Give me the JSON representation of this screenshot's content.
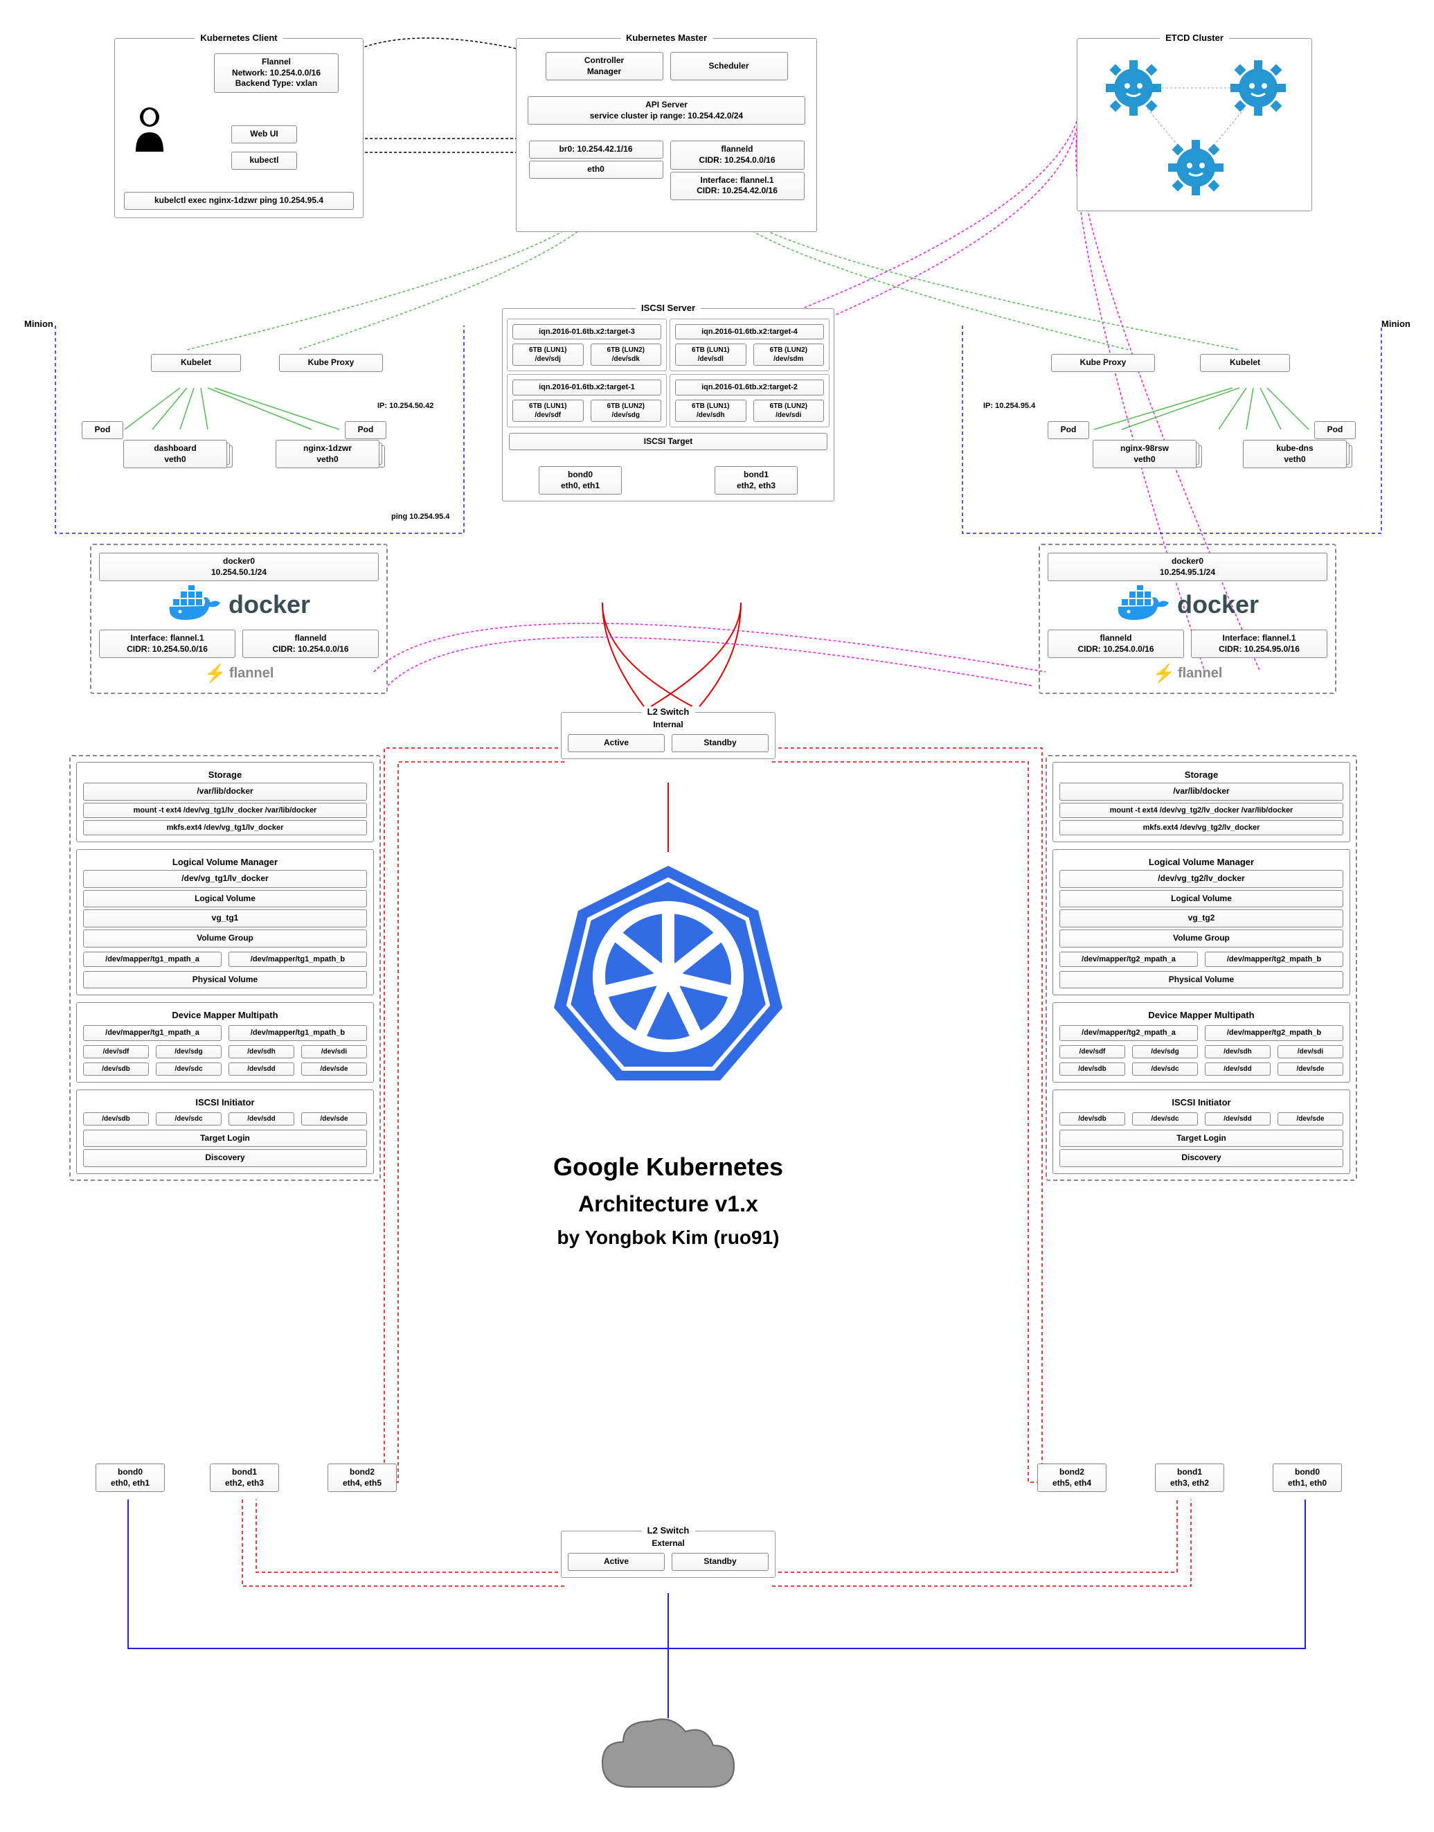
{
  "client": {
    "title": "Kubernetes Client",
    "flannel": "Flannel\nNetwork: 10.254.0.0/16\nBackend Type: vxlan",
    "webui": "Web UI",
    "kubectl": "kubectl",
    "exec": "kubelctl exec nginx-1dzwr ping 10.254.95.4"
  },
  "master": {
    "title": "Kubernetes Master",
    "controller": "Controller\nManager",
    "scheduler": "Scheduler",
    "api_server": "API Server\nservice cluster ip range: 10.254.42.0/24",
    "br0": "br0: 10.254.42.1/16",
    "eth0": "eth0",
    "flanneld": "flanneld\nCIDR: 10.254.0.0/16",
    "interface": "Interface: flannel.1\nCIDR: 10.254.42.0/16"
  },
  "etcd": {
    "title": "ETCD Cluster"
  },
  "iscsi_server": {
    "title": "ISCSI Server",
    "targets": [
      {
        "name": "iqn.2016-01.6tb.x2:target-3",
        "luns": [
          "6TB (LUN1)\n/dev/sdj",
          "6TB (LUN2)\n/dev/sdk"
        ]
      },
      {
        "name": "iqn.2016-01.6tb.x2:target-4",
        "luns": [
          "6TB (LUN1)\n/dev/sdl",
          "6TB (LUN2)\n/dev/sdm"
        ]
      },
      {
        "name": "iqn.2016-01.6tb.x2:target-1",
        "luns": [
          "6TB (LUN1)\n/dev/sdf",
          "6TB (LUN2)\n/dev/sdg"
        ]
      },
      {
        "name": "iqn.2016-01.6tb.x2:target-2",
        "luns": [
          "6TB (LUN1)\n/dev/sdh",
          "6TB (LUN2)\n/dev/sdi"
        ]
      }
    ],
    "target_label": "ISCSI Target",
    "bond0": "bond0\neth0, eth1",
    "bond1": "bond1\neth2, eth3"
  },
  "l2_internal": {
    "title": "L2 Switch",
    "sub": "Internal",
    "active": "Active",
    "standby": "Standby"
  },
  "l2_external": {
    "title": "L2 Switch",
    "sub": "External",
    "active": "Active",
    "standby": "Standby"
  },
  "minion_left": {
    "label": "Minion",
    "kubelet": "Kubelet",
    "kubeproxy": "Kube Proxy",
    "pod1": "Pod",
    "pod2": "Pod",
    "container1": "dashboard\nveth0",
    "container2": "nginx-1dzwr\nveth0",
    "docker0": "docker0\n10.254.50.1/24",
    "docker_logo": "docker",
    "interface": "Interface: flannel.1\nCIDR: 10.254.50.0/16",
    "flanneld": "flanneld\nCIDR: 10.254.0.0/16",
    "flannel_logo": "flannel",
    "ip_ann": "IP: 10.254.50.42",
    "ping_ann": "ping 10.254.95.4",
    "storage": {
      "title": "Storage",
      "varlib": "/var/lib/docker",
      "mount": "mount -t ext4 /dev/vg_tg1/lv_docker /var/lib/docker",
      "mkfs": "mkfs.ext4 /dev/vg_tg1/lv_docker"
    },
    "lvm": {
      "title": "Logical Volume Manager",
      "lv": "/dev/vg_tg1/lv_docker",
      "lv_label": "Logical Volume",
      "vg": "vg_tg1",
      "vg_label": "Volume Group",
      "mpaths": [
        "/dev/mapper/tg1_mpath_a",
        "/dev/mapper/tg1_mpath_b"
      ],
      "pv_label": "Physical Volume"
    },
    "dmm": {
      "title": "Device Mapper Multipath",
      "mpaths": [
        "/dev/mapper/tg1_mpath_a",
        "/dev/mapper/tg1_mpath_b"
      ],
      "devs1": [
        "/dev/sdf",
        "/dev/sdg",
        "/dev/sdh",
        "/dev/sdi"
      ],
      "devs2": [
        "/dev/sdb",
        "/dev/sdc",
        "/dev/sdd",
        "/dev/sde"
      ]
    },
    "iscsi_init": {
      "title": "ISCSI Initiator",
      "devs": [
        "/dev/sdb",
        "/dev/sdc",
        "/dev/sdd",
        "/dev/sde"
      ],
      "target_login": "Target Login",
      "discovery": "Discovery"
    },
    "bonds": {
      "bond0": "bond0\neth0, eth1",
      "bond1": "bond1\neth2, eth3",
      "bond2": "bond2\neth4, eth5"
    }
  },
  "minion_right": {
    "label": "Minion",
    "kubelet": "Kubelet",
    "kubeproxy": "Kube Proxy",
    "pod1": "Pod",
    "pod2": "Pod",
    "container1": "nginx-98rsw\nveth0",
    "container2": "kube-dns\nveth0",
    "docker0": "docker0\n10.254.95.1/24",
    "docker_logo": "docker",
    "interface": "Interface: flannel.1\nCIDR: 10.254.95.0/16",
    "flanneld": "flanneld\nCIDR: 10.254.0.0/16",
    "flannel_logo": "flannel",
    "ip_ann": "IP: 10.254.95.4",
    "storage": {
      "title": "Storage",
      "varlib": "/var/lib/docker",
      "mount": "mount -t ext4 /dev/vg_tg2/lv_docker /var/lib/docker",
      "mkfs": "mkfs.ext4 /dev/vg_tg2/lv_docker"
    },
    "lvm": {
      "title": "Logical Volume Manager",
      "lv": "/dev/vg_tg2/lv_docker",
      "lv_label": "Logical Volume",
      "vg": "vg_tg2",
      "vg_label": "Volume Group",
      "mpaths": [
        "/dev/mapper/tg2_mpath_a",
        "/dev/mapper/tg2_mpath_b"
      ],
      "pv_label": "Physical Volume"
    },
    "dmm": {
      "title": "Device Mapper Multipath",
      "mpaths": [
        "/dev/mapper/tg2_mpath_a",
        "/dev/mapper/tg2_mpath_b"
      ],
      "devs1": [
        "/dev/sdf",
        "/dev/sdg",
        "/dev/sdh",
        "/dev/sdi"
      ],
      "devs2": [
        "/dev/sdb",
        "/dev/sdc",
        "/dev/sdd",
        "/dev/sde"
      ]
    },
    "iscsi_init": {
      "title": "ISCSI Initiator",
      "devs": [
        "/dev/sdb",
        "/dev/sdc",
        "/dev/sdd",
        "/dev/sde"
      ],
      "target_login": "Target Login",
      "discovery": "Discovery"
    },
    "bonds": {
      "bond0": "bond0\neth1, eth0",
      "bond1": "bond1\neth3, eth2",
      "bond2": "bond2\neth5, eth4"
    }
  },
  "title": {
    "line1": "Google Kubernetes",
    "line2": "Architecture v1.x",
    "line3": "by Yongbok Kim (ruo91)"
  }
}
